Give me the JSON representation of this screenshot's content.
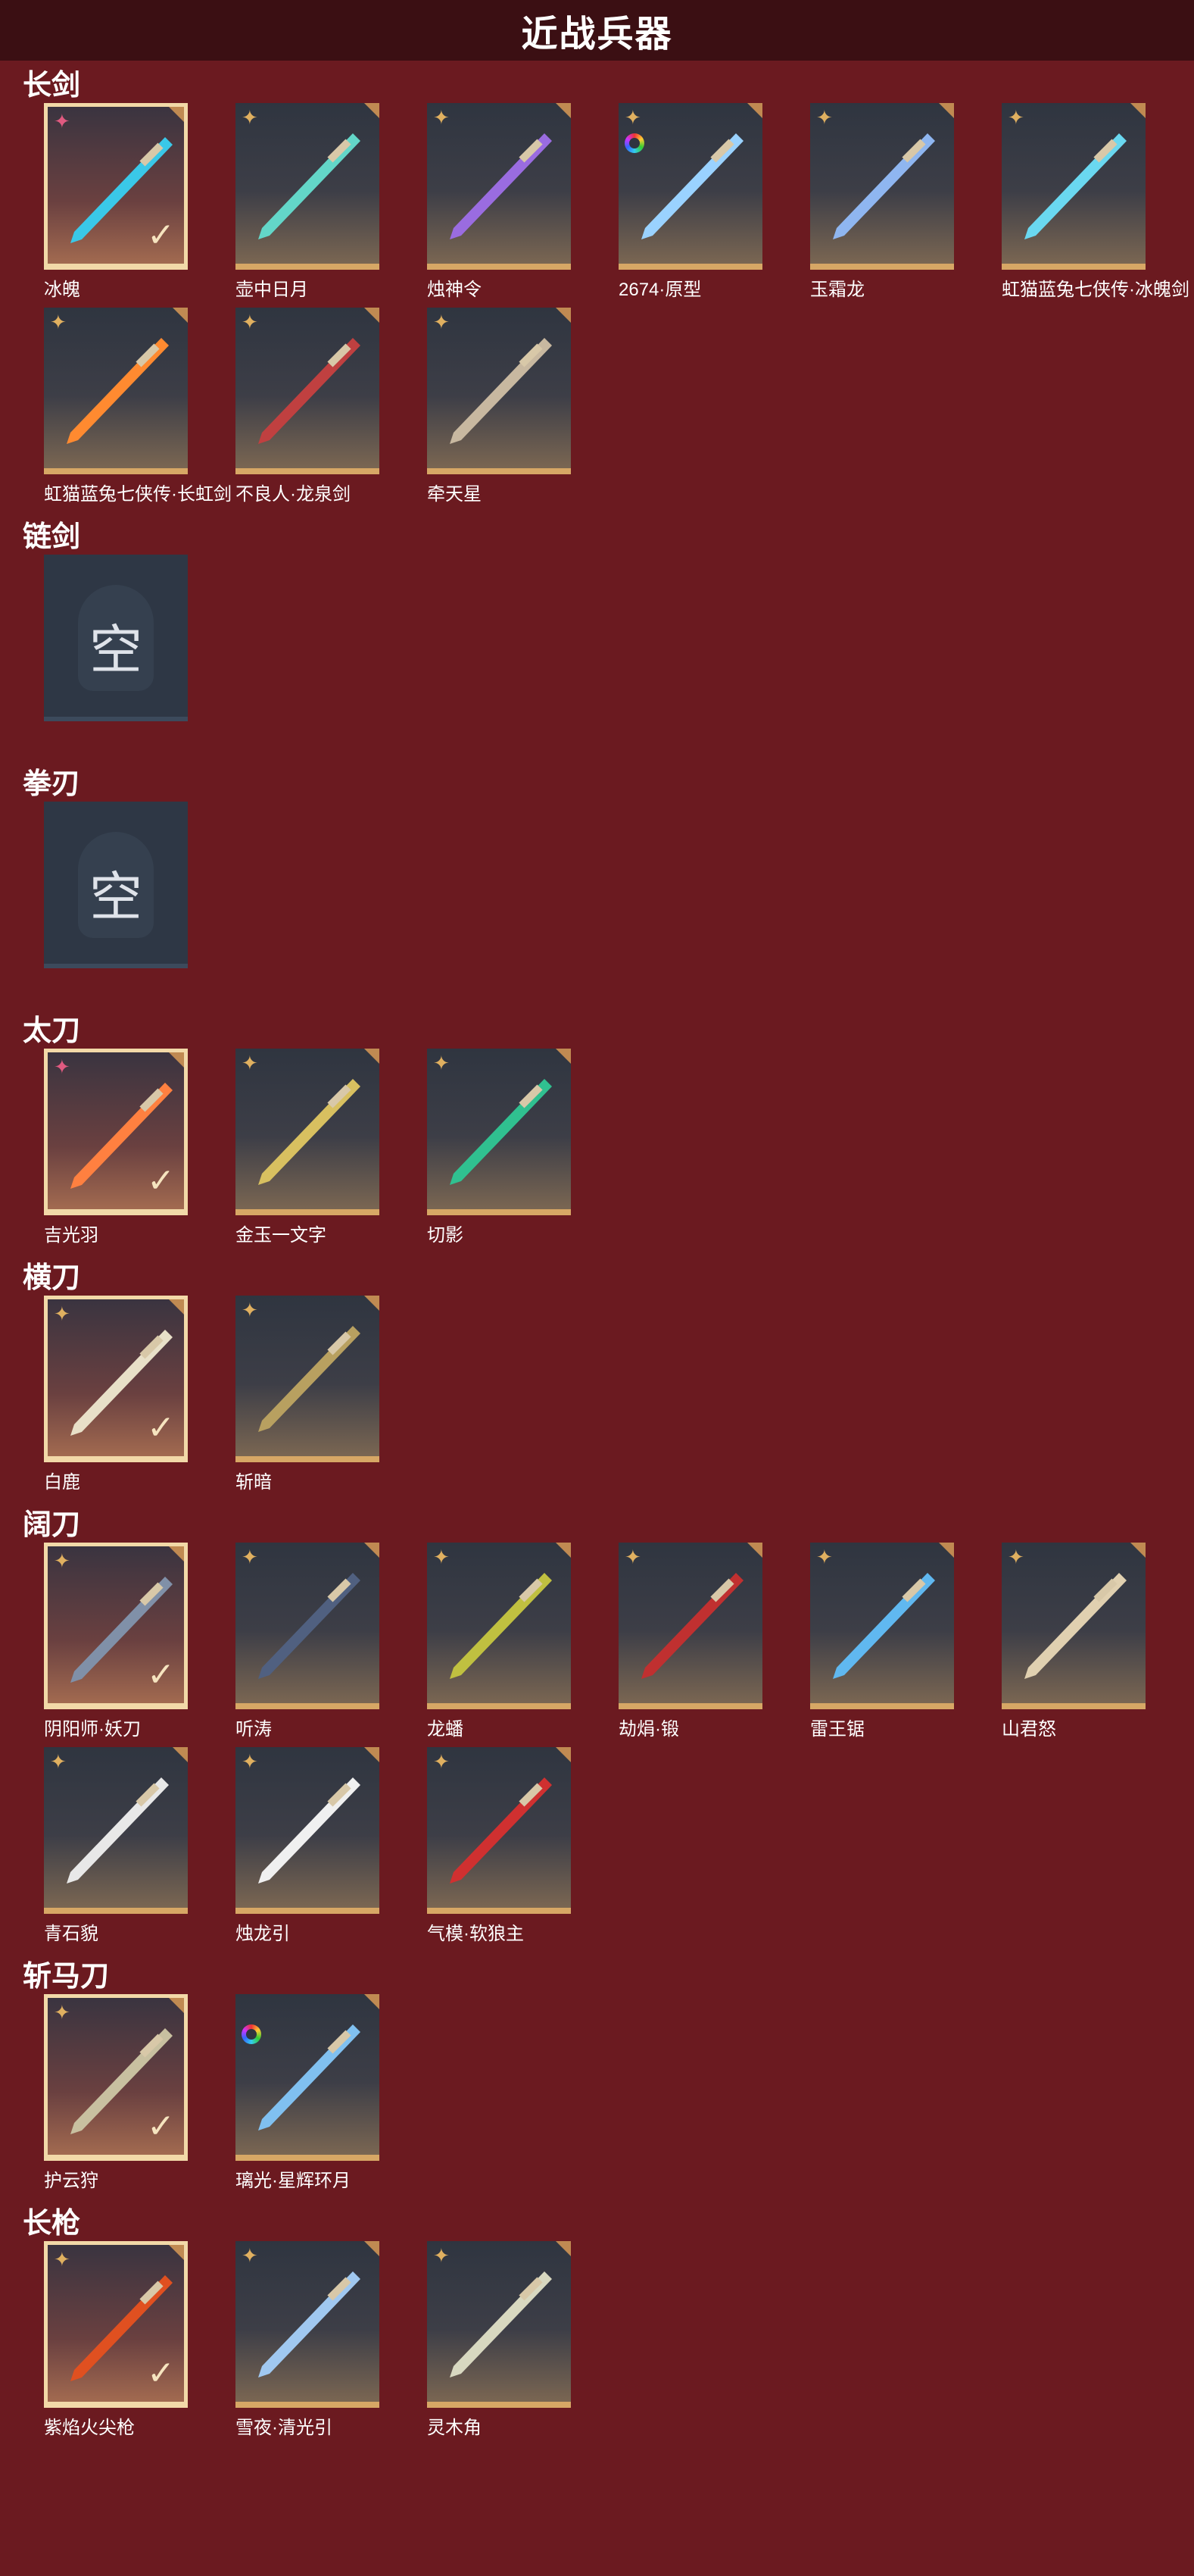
{
  "page_title": "近战兵器",
  "sections": [
    {
      "title": "长剑",
      "items": [
        {
          "name": "冰魄",
          "badge": "pink",
          "selected": true,
          "color": "#3ac8e8"
        },
        {
          "name": "壶中日月",
          "badge": "gold",
          "selected": false,
          "color": "#63d6c8"
        },
        {
          "name": "烛神令",
          "badge": "gold",
          "selected": false,
          "color": "#9a6ce0"
        },
        {
          "name": "2674·原型",
          "badge": "gold",
          "rainbow": true,
          "selected": false,
          "color": "#9ad2ff"
        },
        {
          "name": "玉霜龙",
          "badge": "gold",
          "selected": false,
          "color": "#8fb6f0"
        },
        {
          "name": "虹猫蓝兔七侠传·冰魄剑",
          "badge": "gold",
          "selected": false,
          "color": "#6ad8f0"
        },
        {
          "name": "虹猫蓝兔七侠传·长虹剑",
          "badge": "gold",
          "selected": false,
          "color": "#ff8a30"
        },
        {
          "name": "不良人·龙泉剑",
          "badge": "gold",
          "selected": false,
          "color": "#c04040"
        },
        {
          "name": "牵天星",
          "badge": "gold",
          "selected": false,
          "color": "#c8b8a0"
        }
      ]
    },
    {
      "title": "链剑",
      "items": [
        {
          "name": "",
          "empty": true,
          "empty_label": "空"
        }
      ]
    },
    {
      "title": "拳刃",
      "items": [
        {
          "name": "",
          "empty": true,
          "empty_label": "空"
        }
      ]
    },
    {
      "title": "太刀",
      "items": [
        {
          "name": "吉光羽",
          "badge": "pink",
          "selected": true,
          "color": "#ff8040"
        },
        {
          "name": "金玉一文字",
          "badge": "gold",
          "selected": false,
          "color": "#d8c060"
        },
        {
          "name": "切影",
          "badge": "gold",
          "selected": false,
          "color": "#30c090"
        }
      ]
    },
    {
      "title": "横刀",
      "items": [
        {
          "name": "白鹿",
          "badge": "gold",
          "selected": true,
          "color": "#e8e0c8"
        },
        {
          "name": "斩暗",
          "badge": "gold",
          "selected": false,
          "color": "#b8a060"
        }
      ]
    },
    {
      "title": "阔刀",
      "items": [
        {
          "name": "阴阳师·妖刀",
          "badge": "gold",
          "selected": true,
          "color": "#8090a8"
        },
        {
          "name": "听涛",
          "badge": "gold",
          "selected": false,
          "color": "#506080"
        },
        {
          "name": "龙蟠",
          "badge": "gold",
          "selected": false,
          "color": "#c0c040"
        },
        {
          "name": "劫焆·锻",
          "badge": "gold",
          "selected": false,
          "color": "#c03030"
        },
        {
          "name": "雷王锯",
          "badge": "gold",
          "selected": false,
          "color": "#60b8f0"
        },
        {
          "name": "山君怒",
          "badge": "gold",
          "selected": false,
          "color": "#e0d0b0"
        },
        {
          "name": "青石貌",
          "badge": "gold",
          "selected": false,
          "color": "#e8e8e8"
        },
        {
          "name": "烛龙引",
          "badge": "gold",
          "selected": false,
          "color": "#f0f0f0"
        },
        {
          "name": "气模·软狼主",
          "badge": "gold",
          "selected": false,
          "color": "#d03030"
        }
      ]
    },
    {
      "title": "斩马刀",
      "items": [
        {
          "name": "护云狩",
          "badge": "gold",
          "selected": true,
          "color": "#c8c0a0"
        },
        {
          "name": "璃光·星辉环月",
          "badge": "rainbow",
          "selected": false,
          "color": "#80c0f0"
        }
      ]
    },
    {
      "title": "长枪",
      "items": [
        {
          "name": "紫焰火尖枪",
          "badge": "gold",
          "selected": true,
          "color": "#e05020"
        },
        {
          "name": "雪夜·清光引",
          "badge": "gold",
          "selected": false,
          "color": "#a0c8f0"
        },
        {
          "name": "灵木角",
          "badge": "gold",
          "selected": false,
          "color": "#d8d8c0"
        }
      ]
    }
  ]
}
